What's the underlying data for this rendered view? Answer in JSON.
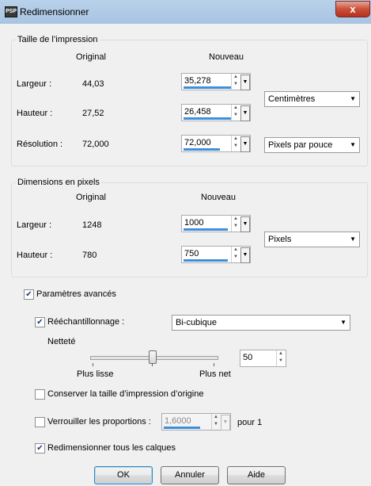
{
  "window": {
    "title": "Redimensionner",
    "close_glyph": "x",
    "app_icon": "app-icon"
  },
  "print_size": {
    "group_title": "Taille de l’impression",
    "col_original": "Original",
    "col_new": "Nouveau",
    "width": {
      "label": "Largeur :",
      "original": "44,03",
      "new": "35,278"
    },
    "height": {
      "label": "Hauteur :",
      "original": "27,52",
      "new": "26,458"
    },
    "resolution": {
      "label": "Résolution :",
      "original": "72,000",
      "new": "72,000"
    },
    "unit_select": "Centimètres",
    "resolution_unit_select": "Pixels par pouce"
  },
  "pixel_dims": {
    "group_title": "Dimensions en pixels",
    "col_original": "Original",
    "col_new": "Nouveau",
    "width": {
      "label": "Largeur :",
      "original": "1248",
      "new": "1000"
    },
    "height": {
      "label": "Hauteur :",
      "original": "780",
      "new": "750"
    },
    "unit_select": "Pixels"
  },
  "advanced": {
    "label": "Paramètres avancés",
    "checked": true,
    "resample": {
      "label": "Rééchantillonnage :",
      "checked": true,
      "method": "Bi-cubique"
    },
    "sharpness": {
      "label": "Netteté",
      "value": "50",
      "level": 0.5,
      "left_label": "Plus lisse",
      "right_label": "Plus net"
    },
    "keep_print_size": {
      "label": "Conserver la taille d’impression d’origine",
      "checked": false
    },
    "lock_ratio": {
      "label": "Verrouiller les proportions :",
      "checked": false,
      "value": "1,6000",
      "suffix": "pour 1"
    },
    "resize_all_layers": {
      "label": "Redimensionner tous les calques",
      "checked": true
    }
  },
  "buttons": {
    "ok": "OK",
    "cancel": "Annuler",
    "help": "Aide"
  },
  "colors": {
    "accent": "#3d8fd9",
    "titlebar": "#b9d1ea",
    "close": "#c9503a"
  }
}
